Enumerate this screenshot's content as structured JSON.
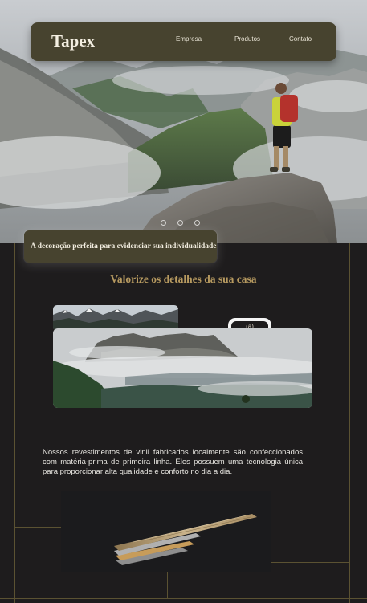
{
  "brand": "Tapex",
  "nav": {
    "items": [
      "Empresa",
      "Produtos",
      "Contato"
    ]
  },
  "hero": {
    "tagline": "A decoração perfeita para evidenciar sua individualidade",
    "slide_count": 3,
    "active_slide": 1
  },
  "section": {
    "title": "Valorize os detalhes da sua casa",
    "badge": "(a)",
    "description": "Nossos revestimentos de vinil fabricados localmente são confeccionados com matéria-prima de primeira linha. Eles possuem uma tecnologia única para proporcionar alta qualidade e conforto no dia a dia."
  },
  "colors": {
    "accent_olive": "#47432f",
    "title_gold": "#b79a60",
    "background": "#1e1c1d",
    "line_gold": "#5b5232"
  }
}
